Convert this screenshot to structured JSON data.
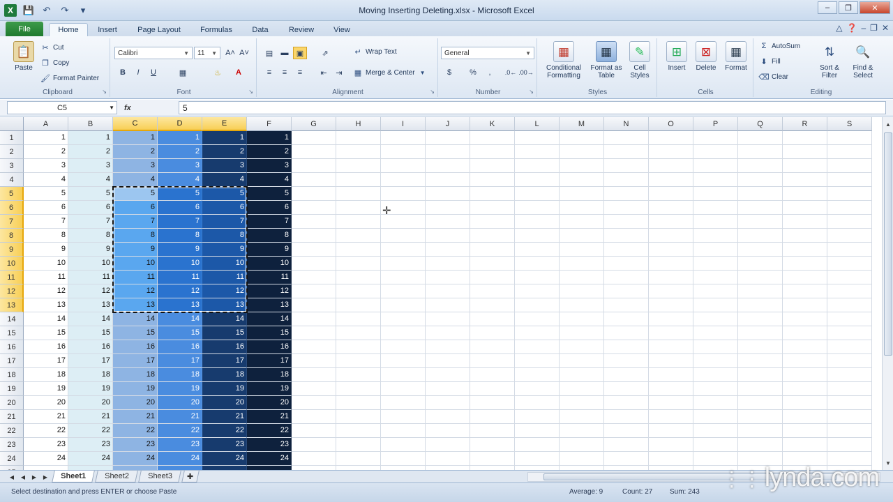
{
  "window": {
    "title": "Moving Inserting Deleting.xlsx - Microsoft Excel",
    "app_logo": "X"
  },
  "ribbon_tabs": [
    "File",
    "Home",
    "Insert",
    "Page Layout",
    "Formulas",
    "Data",
    "Review",
    "View"
  ],
  "active_tab": "Home",
  "ribbon": {
    "clipboard": {
      "label": "Clipboard",
      "paste": "Paste",
      "cut": "Cut",
      "copy": "Copy",
      "format_painter": "Format Painter"
    },
    "font": {
      "label": "Font",
      "font_name": "Calibri",
      "font_size": "11"
    },
    "alignment": {
      "label": "Alignment",
      "wrap_text": "Wrap Text",
      "merge_center": "Merge & Center"
    },
    "number": {
      "label": "Number",
      "format": "General"
    },
    "styles": {
      "label": "Styles",
      "conditional": "Conditional Formatting",
      "format_table": "Format as Table",
      "cell_styles": "Cell Styles"
    },
    "cells": {
      "label": "Cells",
      "insert": "Insert",
      "delete": "Delete",
      "format": "Format"
    },
    "editing": {
      "label": "Editing",
      "autosum": "AutoSum",
      "fill": "Fill",
      "clear": "Clear",
      "sort_filter": "Sort & Filter",
      "find_select": "Find & Select"
    }
  },
  "formula_bar": {
    "name_box": "C5",
    "fx": "fx",
    "value": "5"
  },
  "columns": [
    "A",
    "B",
    "C",
    "D",
    "E",
    "F",
    "G",
    "H",
    "I",
    "J",
    "K",
    "L",
    "M",
    "N",
    "O",
    "P",
    "Q",
    "R",
    "S"
  ],
  "column_fills": {
    "A": "#ffffff",
    "B": "#ddeef5",
    "C": "#8eb4e3",
    "D": "#4a8cdf",
    "E": "#173b6e",
    "F": "#0e213d"
  },
  "selection_fills": {
    "C": "#5aa7ef",
    "D": "#2a73cf",
    "E": "#1c58a8"
  },
  "selected_columns": [
    "C",
    "D",
    "E"
  ],
  "selected_rows": [
    5,
    6,
    7,
    8,
    9,
    10,
    11,
    12,
    13
  ],
  "selection": {
    "range": "C5:E13",
    "active_cell": "C5"
  },
  "rows": [
    [
      1,
      1,
      1,
      1,
      1,
      1
    ],
    [
      2,
      2,
      2,
      2,
      2,
      2
    ],
    [
      3,
      3,
      3,
      3,
      3,
      3
    ],
    [
      4,
      4,
      4,
      4,
      4,
      4
    ],
    [
      5,
      5,
      5,
      5,
      5,
      5
    ],
    [
      6,
      6,
      6,
      6,
      6,
      6
    ],
    [
      7,
      7,
      7,
      7,
      7,
      7
    ],
    [
      8,
      8,
      8,
      8,
      8,
      8
    ],
    [
      9,
      9,
      9,
      9,
      9,
      9
    ],
    [
      10,
      10,
      10,
      10,
      10,
      10
    ],
    [
      11,
      11,
      11,
      11,
      11,
      11
    ],
    [
      12,
      12,
      12,
      12,
      12,
      12
    ],
    [
      13,
      13,
      13,
      13,
      13,
      13
    ],
    [
      14,
      14,
      14,
      14,
      14,
      14
    ],
    [
      15,
      15,
      15,
      15,
      15,
      15
    ],
    [
      16,
      16,
      16,
      16,
      16,
      16
    ],
    [
      17,
      17,
      17,
      17,
      17,
      17
    ],
    [
      18,
      18,
      18,
      18,
      18,
      18
    ],
    [
      19,
      19,
      19,
      19,
      19,
      19
    ],
    [
      20,
      20,
      20,
      20,
      20,
      20
    ],
    [
      21,
      21,
      21,
      21,
      21,
      21
    ],
    [
      22,
      22,
      22,
      22,
      22,
      22
    ],
    [
      23,
      23,
      23,
      23,
      23,
      23
    ],
    [
      24,
      24,
      24,
      24,
      24,
      24
    ]
  ],
  "sheets": [
    "Sheet1",
    "Sheet2",
    "Sheet3"
  ],
  "active_sheet": "Sheet1",
  "status": {
    "message": "Select destination and press ENTER or choose Paste",
    "average": "Average: 9",
    "count": "Count: 27",
    "sum": "Sum: 243"
  },
  "watermark": "lynda.com"
}
